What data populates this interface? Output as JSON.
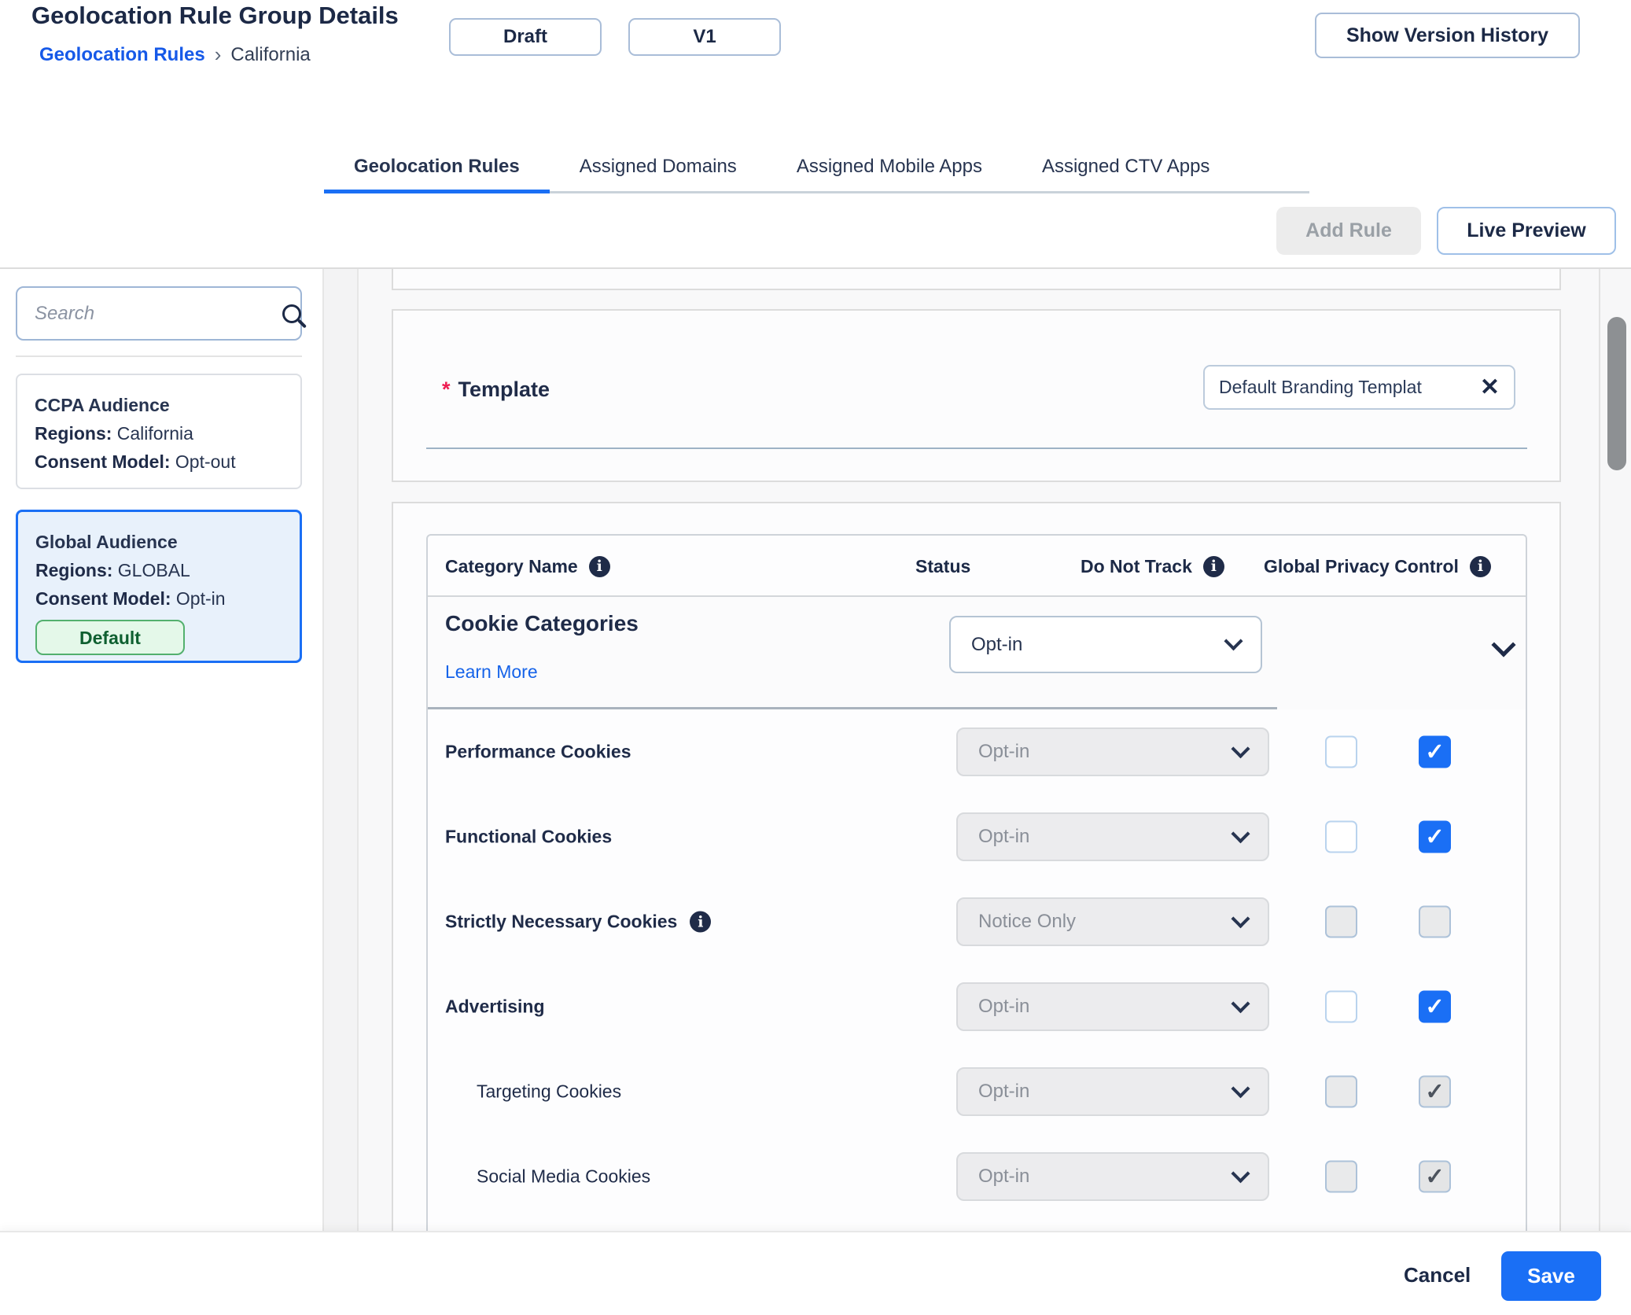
{
  "header": {
    "title": "Geolocation Rule Group Details",
    "breadcrumb": {
      "link": "Geolocation Rules",
      "separator": "›",
      "current": "California"
    },
    "badges": {
      "status": "Draft",
      "version": "V1"
    },
    "version_history_label": "Show Version History"
  },
  "tabs": [
    {
      "label": "Geolocation Rules",
      "active": true
    },
    {
      "label": "Assigned Domains",
      "active": false
    },
    {
      "label": "Assigned Mobile Apps",
      "active": false
    },
    {
      "label": "Assigned CTV Apps",
      "active": false
    }
  ],
  "toolbar": {
    "add_rule_label": "Add Rule",
    "add_rule_disabled": true,
    "live_preview_label": "Live Preview"
  },
  "sidebar": {
    "search_placeholder": "Search",
    "cards": [
      {
        "title": "CCPA Audience",
        "regions_label": "Regions:",
        "regions": "California",
        "consent_label": "Consent Model:",
        "consent": "Opt-out",
        "selected": false
      },
      {
        "title": "Global Audience",
        "regions_label": "Regions:",
        "regions": "GLOBAL",
        "consent_label": "Consent Model:",
        "consent": "Opt-in",
        "badge": "Default",
        "selected": true
      }
    ]
  },
  "template_section": {
    "required_mark": "*",
    "label": "Template",
    "chip_text": "Default Branding Templat",
    "chip_close": "✕"
  },
  "table": {
    "headers": {
      "category": "Category Name",
      "status": "Status",
      "dnt": "Do Not Track",
      "gpc": "Global Privacy Control"
    },
    "group": {
      "name": "Cookie Categories",
      "link_label": "Learn More",
      "status": "Opt-in",
      "status_disabled": false
    },
    "rows": [
      {
        "name": "Performance Cookies",
        "bold": true,
        "indent": false,
        "info": false,
        "status": "Opt-in",
        "status_disabled": true,
        "dnt": {
          "checked": false,
          "disabled": false
        },
        "gpc": {
          "checked": true,
          "disabled": false
        }
      },
      {
        "name": "Functional Cookies",
        "bold": true,
        "indent": false,
        "info": false,
        "status": "Opt-in",
        "status_disabled": true,
        "dnt": {
          "checked": false,
          "disabled": false
        },
        "gpc": {
          "checked": true,
          "disabled": false
        }
      },
      {
        "name": "Strictly Necessary Cookies",
        "bold": true,
        "indent": false,
        "info": true,
        "status": "Notice Only",
        "status_disabled": true,
        "dnt": {
          "checked": false,
          "disabled": true
        },
        "gpc": {
          "checked": false,
          "disabled": true
        }
      },
      {
        "name": "Advertising",
        "bold": true,
        "indent": false,
        "info": false,
        "status": "Opt-in",
        "status_disabled": true,
        "dnt": {
          "checked": false,
          "disabled": false
        },
        "gpc": {
          "checked": true,
          "disabled": false
        }
      },
      {
        "name": "Targeting Cookies",
        "bold": false,
        "indent": true,
        "info": false,
        "status": "Opt-in",
        "status_disabled": true,
        "dnt": {
          "checked": false,
          "disabled": true
        },
        "gpc": {
          "checked": true,
          "disabled": true
        }
      },
      {
        "name": "Social Media Cookies",
        "bold": false,
        "indent": true,
        "info": false,
        "status": "Opt-in",
        "status_disabled": true,
        "dnt": {
          "checked": false,
          "disabled": true
        },
        "gpc": {
          "checked": true,
          "disabled": true
        }
      }
    ],
    "checkmark": "✓"
  },
  "footer": {
    "cancel_label": "Cancel",
    "save_label": "Save"
  },
  "colors": {
    "accent": "#1a6ff5",
    "link": "#1663e9",
    "navy": "#1f2b48",
    "danger": "#ee1d52",
    "badge_green_bg": "#e4f8e9",
    "badge_green_border": "#53b06e",
    "badge_green_text": "#0e5f30"
  }
}
